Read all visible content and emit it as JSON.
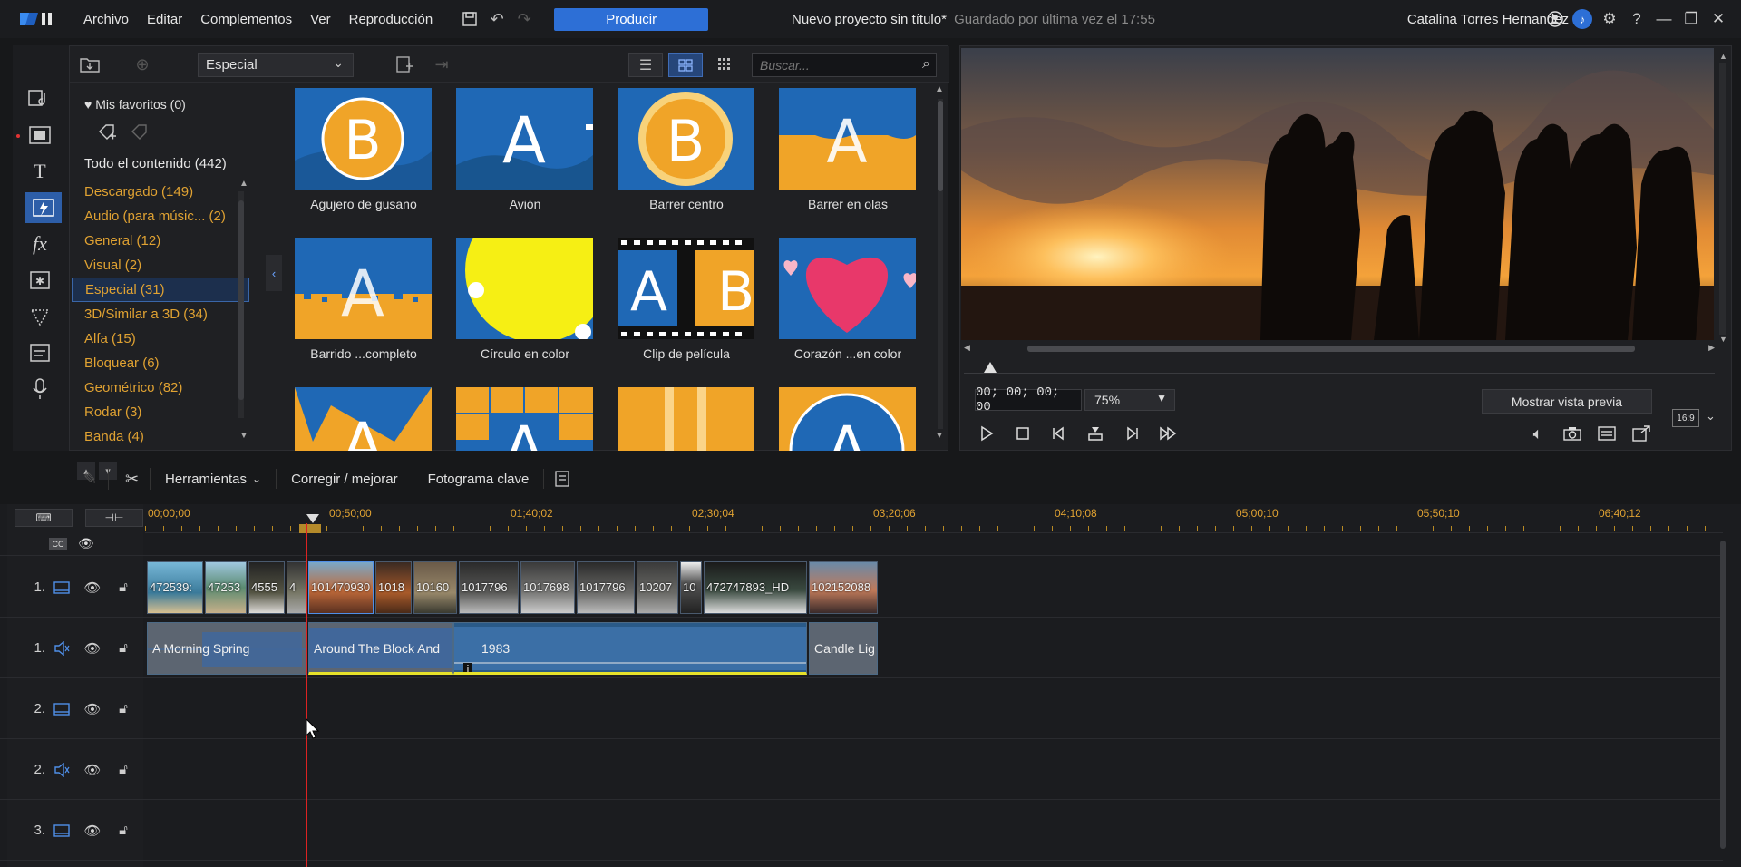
{
  "menu": [
    "Archivo",
    "Editar",
    "Complementos",
    "Ver",
    "Reproducción"
  ],
  "produce_label": "Producir",
  "project": {
    "title": "Nuevo proyecto sin título*",
    "saved": "Guardado por última vez el 17:55"
  },
  "user": "Catalina Torres Hernandez",
  "library": {
    "dropdown": "Especial",
    "search_placeholder": "Buscar...",
    "favorites": "Mis favoritos (0)",
    "all_content": "Todo el contenido (442)",
    "categories": [
      "Descargado  (149)",
      "Audio (para músic...  (2)",
      "General  (12)",
      "Visual  (2)",
      "Especial  (31)",
      "3D/Similar a 3D  (34)",
      "Alfa  (15)",
      "Bloquear  (6)",
      "Geométrico  (82)",
      "Rodar  (3)",
      "Banda  (4)"
    ],
    "selected_category": "Especial  (31)",
    "tiles": [
      "Agujero de gusano",
      "Avión",
      "Barrer centro",
      "Barrer en olas",
      "Barrido ...completo",
      "Círculo en color",
      "Clip de película",
      "Corazón ...en color",
      "",
      "",
      "",
      ""
    ]
  },
  "preview": {
    "timecode": "00; 00; 00; 00",
    "zoom": "75%",
    "show_preview": "Mostrar vista previa",
    "aspect": "16:9"
  },
  "toolbar": {
    "tools": "Herramientas",
    "fix": "Corregir / mejorar",
    "keyframe": "Fotograma clave"
  },
  "timeline": {
    "ruler": [
      "00;00;00",
      "00;50;00",
      "01;40;02",
      "02;30;04",
      "03;20;06",
      "04;10;08",
      "05;00;10",
      "05;50;10",
      "06;40;12"
    ],
    "track_numbers": [
      "1.",
      "1.",
      "2.",
      "2.",
      "3."
    ],
    "video_clips": [
      "472539:",
      "47253",
      "4555",
      "4",
      "101470930",
      "1018",
      "10160",
      "1017796",
      "1017698",
      "1017796",
      "10207",
      "10",
      "472747893_HD",
      "102152088"
    ],
    "audio_clips": [
      "A Morning Spring",
      "Around The Block And",
      "1983",
      "Candle Lig"
    ]
  },
  "colors": {
    "accent": "#2d6fd6",
    "category": "#e0a232",
    "playhead": "#dd2222"
  }
}
